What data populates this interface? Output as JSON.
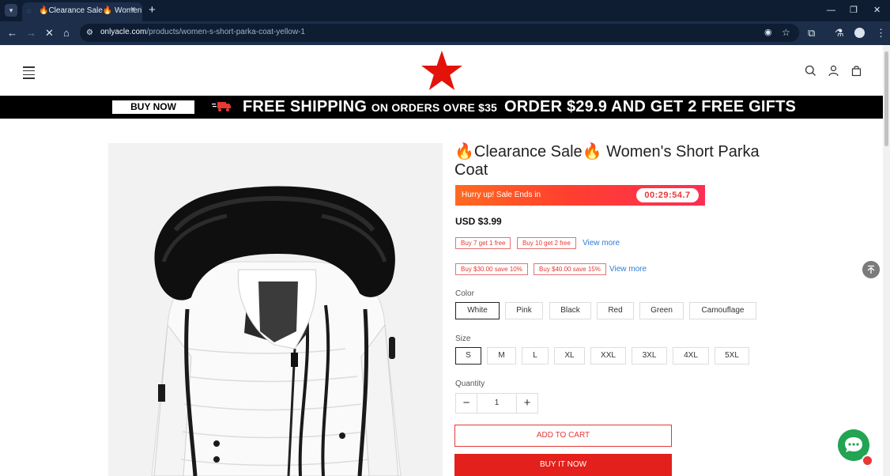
{
  "browser": {
    "tab_title": "🔥Clearance Sale🔥 Women's",
    "tab_close": "×",
    "new_tab": "+",
    "url_domain": "onlyacle.com",
    "url_path": "/products/women-s-short-parka-coat-yellow-1",
    "window_controls": [
      "—",
      "❐",
      "✕"
    ]
  },
  "banner": {
    "buy_now": "BUY NOW",
    "free_shipping": "FREE SHIPPING",
    "on_orders": "ON ORDERS OVRE $35",
    "order_offer": "ORDER $29.9 AND GET 2 FREE GIFTS"
  },
  "product": {
    "title": "🔥Clearance Sale🔥 Women's Short Parka Coat",
    "timer_label": "Hurry up! Sale Ends in",
    "timer_value": "00:29:54.7",
    "price": "USD $3.99",
    "coupons_row1": [
      "Buy 7 get 1 free",
      "Buy 10 get 2 free"
    ],
    "coupons_row2": [
      "Buy $30.00 save 10%",
      "Buy $40.00 save 15%"
    ],
    "view_more": "View more",
    "color_label": "Color",
    "colors": [
      "White",
      "Pink",
      "Black",
      "Red",
      "Green",
      "Camouflage"
    ],
    "selected_color": "White",
    "size_label": "Size",
    "sizes": [
      "S",
      "M",
      "L",
      "XL",
      "XXL",
      "3XL",
      "4XL",
      "5XL"
    ],
    "selected_size": "S",
    "quantity_label": "Quantity",
    "quantity": "1",
    "minus": "−",
    "plus": "+",
    "add_to_cart": "ADD TO CART",
    "buy_it_now": "BUY IT NOW"
  },
  "colors": {
    "accent_red": "#e3201b",
    "link_blue": "#2f7bd4",
    "chat_green": "#22a453"
  },
  "icons": [
    "menu-icon",
    "star-logo",
    "search-icon",
    "user-icon",
    "cart-icon",
    "truck-icon",
    "back-to-top-icon",
    "chat-icon"
  ]
}
